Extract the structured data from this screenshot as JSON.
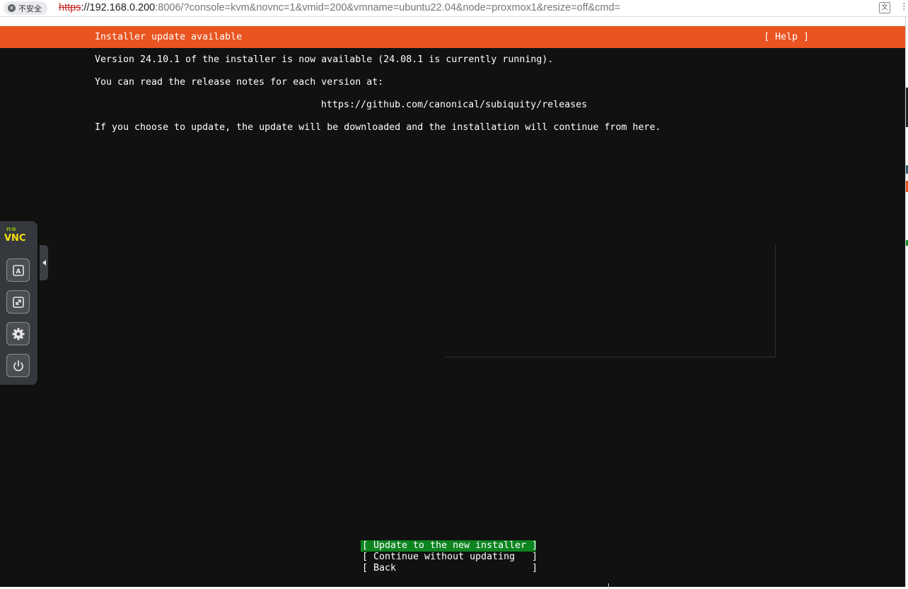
{
  "browser": {
    "security_label": "不安全",
    "url_scheme": "https",
    "url_host": "://192.168.0.200",
    "url_rest": ":8006/?console=kvm&novnc=1&vmid=200&vmname=ubuntu22.04&node=proxmox1&resize=off&cmd="
  },
  "installer": {
    "header_title": "Installer update available",
    "help_label": "[ Help ]",
    "line_version": "Version 24.10.1 of the installer is now available (24.08.1 is currently running).",
    "line_release_notes": "You can read the release notes for each version at:",
    "release_url": "https://github.com/canonical/subiquity/releases",
    "line_update_info": "If you choose to update, the update will be downloaded and the installation will continue from here.",
    "choices": [
      {
        "label": "[ Update to the new installer ]",
        "selected": true
      },
      {
        "label": "[ Continue without updating   ]",
        "selected": false
      },
      {
        "label": "[ Back                        ]",
        "selected": false
      }
    ]
  },
  "novnc": {
    "logo_top": "no",
    "logo_bottom": "VNC",
    "buttons": [
      "keyboard-icon",
      "fullscreen-icon",
      "settings-icon",
      "power-icon"
    ]
  },
  "colors": {
    "header_orange": "#e95420",
    "selected_green": "#0e8420",
    "console_bg": "#111111"
  }
}
